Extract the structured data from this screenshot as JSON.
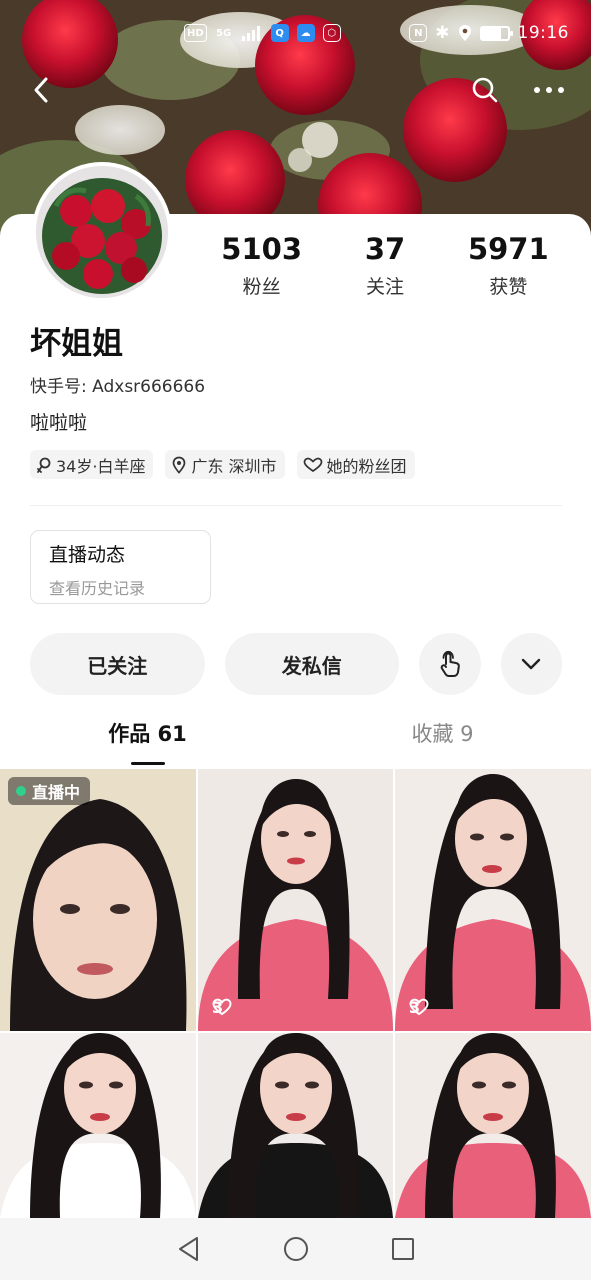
{
  "status_bar": {
    "hd": "HD",
    "network": "5G",
    "time": "19:16",
    "battery_level": 0.75
  },
  "profile": {
    "name": "坏姐姐",
    "kuaishou_id": "快手号: Adxsr666666",
    "bio": "啦啦啦",
    "stats": [
      {
        "value": "5103",
        "label": "粉丝"
      },
      {
        "value": "37",
        "label": "关注"
      },
      {
        "value": "5971",
        "label": "获赞"
      }
    ],
    "tags": [
      {
        "icon": "gender-female-icon",
        "text": "34岁·白羊座"
      },
      {
        "icon": "location-pin-icon",
        "text": "广东 深圳市"
      },
      {
        "icon": "fan-club-heart-icon",
        "text": "她的粉丝团"
      }
    ]
  },
  "live_record": {
    "title": "直播动态",
    "subtitle": "查看历史记录"
  },
  "actions": {
    "followed_label": "已关注",
    "message_label": "发私信"
  },
  "tabs": [
    {
      "label": "作品 61",
      "active": true
    },
    {
      "label": "收藏 9",
      "active": false
    }
  ],
  "videos": [
    {
      "badge": "直播中",
      "likes": ""
    },
    {
      "badge": "",
      "likes": "3"
    },
    {
      "badge": "",
      "likes": "3"
    },
    {
      "badge": "",
      "likes": ""
    },
    {
      "badge": "",
      "likes": ""
    },
    {
      "badge": "",
      "likes": ""
    }
  ],
  "colors": {
    "accent_live": "#2fd08b",
    "rose_red": "#c8102e",
    "button_bg": "#f3f3f3"
  }
}
